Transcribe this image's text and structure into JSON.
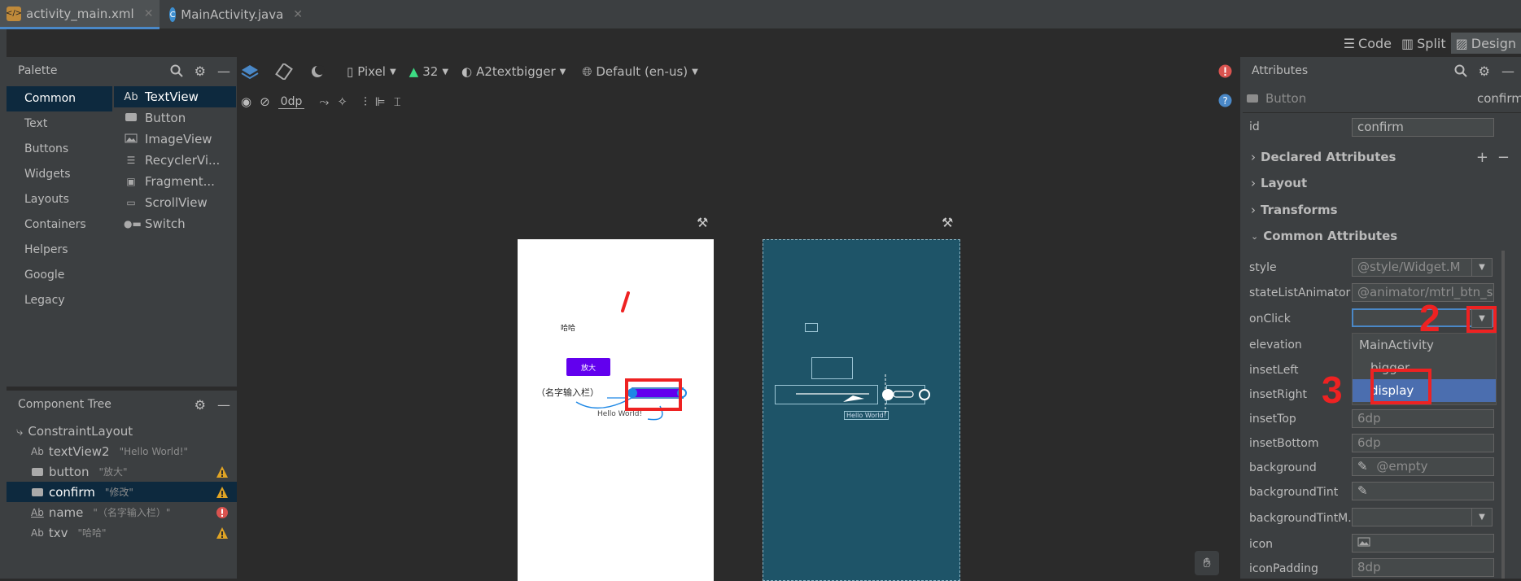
{
  "tabs": [
    {
      "label": "activity_main.xml",
      "icon": "xml-file-icon",
      "active": true
    },
    {
      "label": "MainActivity.java",
      "icon": "java-class-icon",
      "active": false
    }
  ],
  "modes": {
    "code": "Code",
    "split": "Split",
    "design": "Design"
  },
  "palette": {
    "title": "Palette",
    "categories": [
      "Common",
      "Text",
      "Buttons",
      "Widgets",
      "Layouts",
      "Containers",
      "Helpers",
      "Google",
      "Legacy"
    ],
    "items": [
      {
        "icon": "Ab",
        "label": "TextView"
      },
      {
        "icon": "button-icon",
        "label": "Button"
      },
      {
        "icon": "image-icon",
        "label": "ImageView"
      },
      {
        "icon": "list-icon",
        "label": "RecyclerVi..."
      },
      {
        "icon": "fragment-icon",
        "label": "Fragment..."
      },
      {
        "icon": "scroll-icon",
        "label": "ScrollView"
      },
      {
        "icon": "switch-icon",
        "label": "Switch"
      }
    ]
  },
  "component_tree": {
    "title": "Component Tree",
    "root": "ConstraintLayout",
    "rows": [
      {
        "icon": "Ab",
        "name": "textView2",
        "hint": "\"Hello World!\"",
        "status": ""
      },
      {
        "icon": "button-icon",
        "name": "button",
        "hint": "\"放大\"",
        "status": "warning"
      },
      {
        "icon": "button-icon",
        "name": "confirm",
        "hint": "\"修改\"",
        "status": "warning"
      },
      {
        "icon": "Ab",
        "name": "name",
        "hint": "\"（名字输入栏）\"",
        "status": "error"
      },
      {
        "icon": "Ab",
        "name": "txv",
        "hint": "\"哈哈\"",
        "status": "warning"
      }
    ]
  },
  "toolbar": {
    "device": "Pixel",
    "api": "32",
    "theme": "A2textbigger",
    "locale": "Default (en-us)",
    "margin": "0dp"
  },
  "preview": {
    "label_text": "哈哈",
    "button_text": "放大",
    "name_text": "（名字输入栏）",
    "hello_text": "Hello World!",
    "blueprint_hello": "Hello World!",
    "annotation_1": "1"
  },
  "attributes": {
    "title": "Attributes",
    "widget_type": "Button",
    "widget_id_short": "confirm",
    "id_label": "id",
    "id_value": "confirm",
    "sections": {
      "declared": "Declared Attributes",
      "layout": "Layout",
      "transforms": "Transforms",
      "common": "Common Attributes"
    },
    "rows": {
      "style": {
        "label": "style",
        "value": "@style/Widget.M"
      },
      "stateListAnimator": {
        "label": "stateListAnimator",
        "value": "@animator/mtrl_btn_sta"
      },
      "onClick": {
        "label": "onClick",
        "value": ""
      },
      "elevation": {
        "label": "elevation"
      },
      "insetLeft": {
        "label": "insetLeft"
      },
      "insetRight": {
        "label": "insetRight"
      },
      "insetTop": {
        "label": "insetTop",
        "value": "6dp"
      },
      "insetBottom": {
        "label": "insetBottom",
        "value": "6dp"
      },
      "background": {
        "label": "background",
        "value": "@empty"
      },
      "backgroundTint": {
        "label": "backgroundTint",
        "value": ""
      },
      "backgroundTintMode": {
        "label": "backgroundTintM...",
        "value": ""
      },
      "icon": {
        "label": "icon",
        "value": ""
      },
      "iconPadding": {
        "label": "iconPadding",
        "value": "8dp"
      }
    },
    "onclick_dropdown": {
      "header": "MainActivity",
      "options": [
        "bigger",
        "display"
      ],
      "selected": "display"
    },
    "annotation_2": "2",
    "annotation_3": "3"
  },
  "colors": {
    "accent": "#4a88c7",
    "purple_button": "#6200ee",
    "blueprint_bg": "#1e5468",
    "annotation_red": "#ee2222",
    "selection_bg": "#0d293e",
    "dropdown_selected": "#4b6eaf"
  }
}
